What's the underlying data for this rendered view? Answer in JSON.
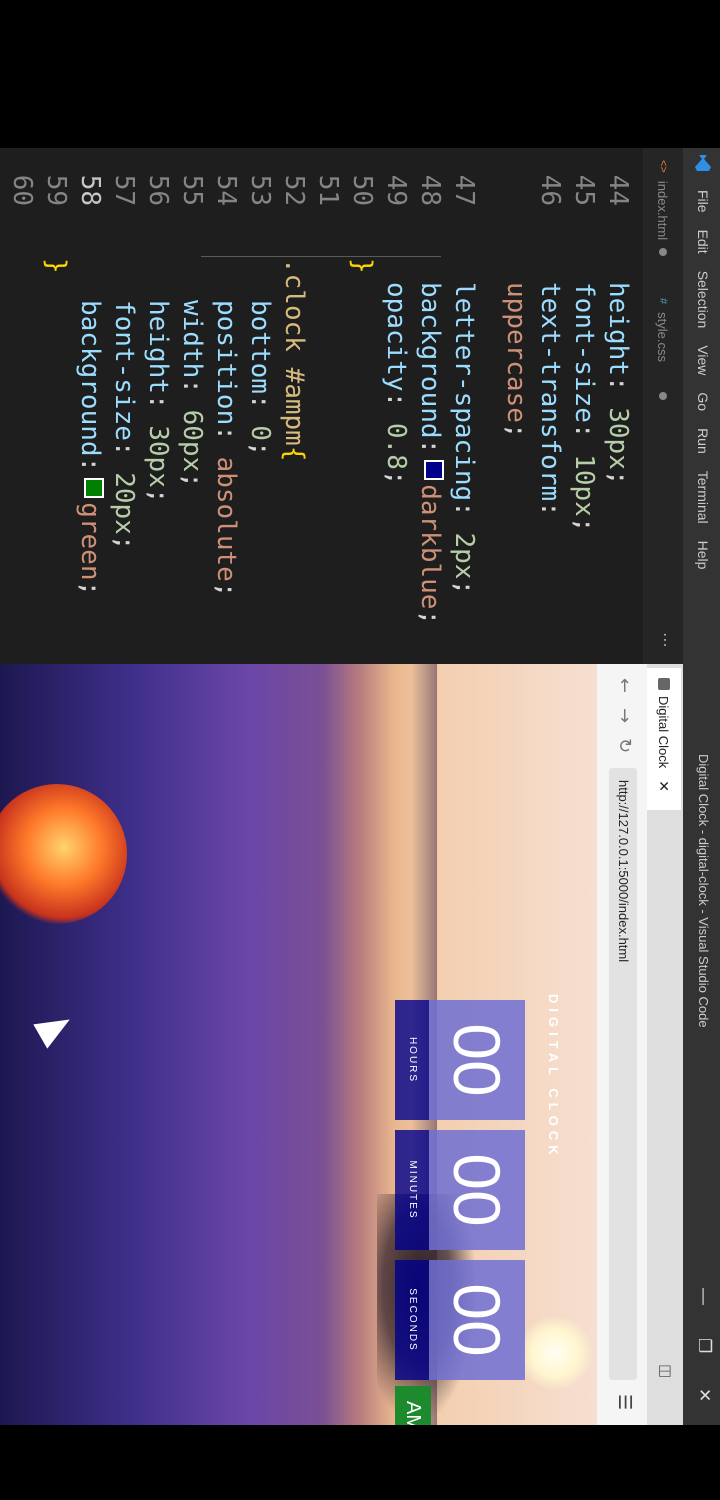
{
  "titlebar": {
    "menu": [
      "File",
      "Edit",
      "Selection",
      "View",
      "Go",
      "Run",
      "Terminal",
      "Help"
    ],
    "window_title": "Digital Clock - digital-clock - Visual Studio Code"
  },
  "editor": {
    "tabs": [
      {
        "label": "index.html"
      },
      {
        "label": "style.css"
      }
    ],
    "line_numbers": [
      "44",
      "45",
      "46",
      "",
      "47",
      "48",
      "49",
      "50",
      "51",
      "52",
      "53",
      "54",
      "55",
      "56",
      "57",
      "58",
      "59",
      "60"
    ],
    "lines": {
      "l44": {
        "prop": "height",
        "val": "30px"
      },
      "l45": {
        "prop": "font-size",
        "val": "10px"
      },
      "l46": {
        "prop": "text-transform",
        "val": "uppercase"
      },
      "l47": {
        "prop": "letter-spacing",
        "val": "2px"
      },
      "l48": {
        "prop": "background",
        "val": "darkblue"
      },
      "l49": {
        "prop": "opacity",
        "val": "0.8"
      },
      "l52": {
        "selector": ".clock #ampm"
      },
      "l53": {
        "prop": "bottom",
        "val": "0"
      },
      "l54": {
        "prop": "position",
        "val": "absolute"
      },
      "l55": {
        "prop": "width",
        "val": "60px"
      },
      "l56": {
        "prop": "height",
        "val": "30px"
      },
      "l57": {
        "prop": "font-size",
        "val": "20px"
      },
      "l58": {
        "prop": "background",
        "val": "green"
      }
    },
    "colors": {
      "darkblue": "#00008b",
      "green": "#008000"
    }
  },
  "browser": {
    "tab_title": "Digital Clock",
    "url": "http://127.0.0.1:5000/index.html",
    "page": {
      "title": "DIGITAL CLOCK",
      "hours": "00",
      "minutes": "00",
      "seconds": "00",
      "hours_label": "HOURS",
      "minutes_label": "MINUTES",
      "seconds_label": "SECONDS",
      "ampm": "AM"
    }
  }
}
